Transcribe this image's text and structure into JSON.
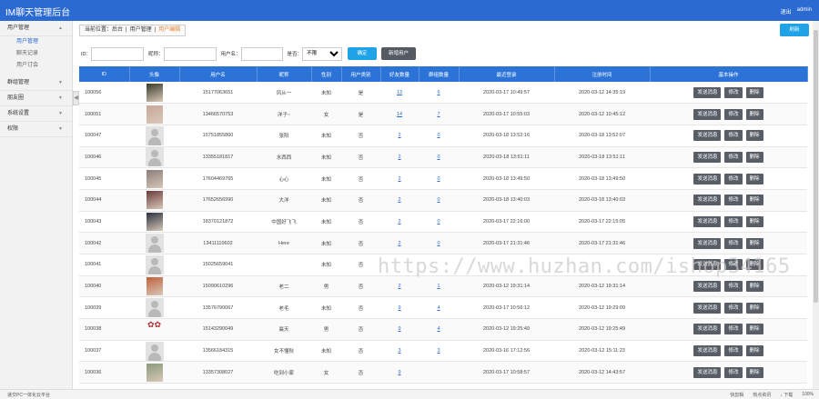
{
  "app": {
    "title": "IM聊天管理后台",
    "logout": "退出",
    "user": "admin"
  },
  "sidebar": {
    "groups": [
      {
        "label": "用户管理",
        "expanded": true,
        "items": [
          "用户管理",
          "聊天记录",
          "用户订会"
        ]
      },
      {
        "label": "群组管理"
      },
      {
        "label": "朋友圈"
      },
      {
        "label": "系统设置"
      },
      {
        "label": "权限"
      }
    ]
  },
  "breadcrumb": {
    "prefix": "当前位置：后台",
    "sep1": "|",
    "parent": "用户管理",
    "sep2": "|",
    "current": "用户编辑"
  },
  "refresh_label": "刷新",
  "filters": {
    "id_label": "ID：",
    "nick_label": "昵称：",
    "user_label": "用户名：",
    "is_label": "是否：",
    "select_value": "不限",
    "confirm": "确定",
    "add_user": "新增用户"
  },
  "columns": [
    "ID",
    "头像",
    "用户名",
    "昵称",
    "性别",
    "用户类别",
    "好友数量",
    "群组数量",
    "最近登录",
    "注册时间",
    "基本操作"
  ],
  "ops": {
    "send": "发送消息",
    "edit": "修改",
    "delete": "删除"
  },
  "rows": [
    {
      "id": "100056",
      "avatar": "photo",
      "avc": "#3a3a2a",
      "username": "15177063651",
      "nick": "风从一",
      "gender": "未知",
      "type": "是",
      "friends": "13",
      "groups": "6",
      "last": "2020-03-17 10:49:57",
      "reg": "2020-03-12 14:35:19"
    },
    {
      "id": "100051",
      "avatar": "photo",
      "avc": "#c9a79a",
      "username": "13466570753",
      "nick": "洋子~",
      "gender": "女",
      "type": "是",
      "friends": "14",
      "groups": "7",
      "last": "2020-03-17 10:55:03",
      "reg": "2020-03-12 10:45:12"
    },
    {
      "id": "100047",
      "avatar": "default",
      "avc": "",
      "username": "15751855860",
      "nick": "张阳",
      "gender": "未知",
      "type": "否",
      "friends": "2",
      "groups": "0",
      "last": "2020-03-18 13:52:16",
      "reg": "2020-03-18 13:52:07"
    },
    {
      "id": "100046",
      "avatar": "default",
      "avc": "",
      "username": "13355181817",
      "nick": "水西西",
      "gender": "未知",
      "type": "否",
      "friends": "2",
      "groups": "0",
      "last": "2020-03-18 13:51:11",
      "reg": "2020-03-18 13:51:11"
    },
    {
      "id": "100045",
      "avatar": "photo",
      "avc": "#8a7c7a",
      "username": "17604469765",
      "nick": "心心",
      "gender": "未知",
      "type": "否",
      "friends": "2",
      "groups": "0",
      "last": "2020-03-18 13:49:50",
      "reg": "2020-03-18 13:49:50"
    },
    {
      "id": "100044",
      "avatar": "photo",
      "avc": "#6a3a3a",
      "username": "17652656990",
      "nick": "大洋",
      "gender": "未知",
      "type": "否",
      "friends": "2",
      "groups": "0",
      "last": "2020-03-18 13:40:03",
      "reg": "2020-03-18 13:40:03"
    },
    {
      "id": "100043",
      "avatar": "photo",
      "avc": "#2a3040",
      "username": "18370121872",
      "nick": "中国好飞飞",
      "gender": "未知",
      "type": "否",
      "friends": "2",
      "groups": "0",
      "last": "2020-03-17 22:16:00",
      "reg": "2020-03-17 22:15:05"
    },
    {
      "id": "100042",
      "avatar": "default",
      "avc": "",
      "username": "13411110602",
      "nick": "Here",
      "gender": "未知",
      "type": "否",
      "friends": "2",
      "groups": "0",
      "last": "2020-03-17 21:31:46",
      "reg": "2020-03-17 21:31:46"
    },
    {
      "id": "100041",
      "avatar": "default",
      "avc": "",
      "username": "15025659041",
      "nick": "",
      "gender": "未知",
      "type": "否",
      "friends": "",
      "groups": "",
      "last": "",
      "reg": ""
    },
    {
      "id": "100040",
      "avatar": "photo",
      "avc": "#c0603a",
      "username": "15090610296",
      "nick": "老二",
      "gender": "男",
      "type": "否",
      "friends": "2",
      "groups": "1",
      "last": "2020-03-12 19:31:14",
      "reg": "2020-03-12 19:31:14"
    },
    {
      "id": "100039",
      "avatar": "default",
      "avc": "",
      "username": "13576790067",
      "nick": "老毛",
      "gender": "未知",
      "type": "否",
      "friends": "9",
      "groups": "4",
      "last": "2020-03-17 10:56:12",
      "reg": "2020-03-12 19:29:09"
    },
    {
      "id": "100038",
      "avatar": "text",
      "avc": "#b03030",
      "username": "15143290049",
      "nick": "晨天",
      "gender": "男",
      "type": "否",
      "friends": "9",
      "groups": "4",
      "last": "2020-03-12 19:25:49",
      "reg": "2020-03-12 19:25:49"
    },
    {
      "id": "100037",
      "avatar": "default",
      "avc": "",
      "username": "13566184315",
      "nick": "女不懂秋",
      "gender": "未知",
      "type": "否",
      "friends": "3",
      "groups": "3",
      "last": "2020-03-16 17:12:56",
      "reg": "2020-03-12 15:11:23"
    },
    {
      "id": "100036",
      "avatar": "photo",
      "avc": "#8a9a7a",
      "username": "13357308027",
      "nick": "吃到小家",
      "gender": "女",
      "type": "否",
      "friends": "9",
      "groups": "",
      "last": "2020-03-17 10:58:57",
      "reg": "2020-03-12 14:43:57"
    }
  ],
  "watermark": "https://www.huzhan.com/ishop34165",
  "status": {
    "left": "递交PC一体化云平台",
    "items": [
      "快剪辑",
      "热点资讯",
      "↓ 下载",
      "100%"
    ]
  }
}
